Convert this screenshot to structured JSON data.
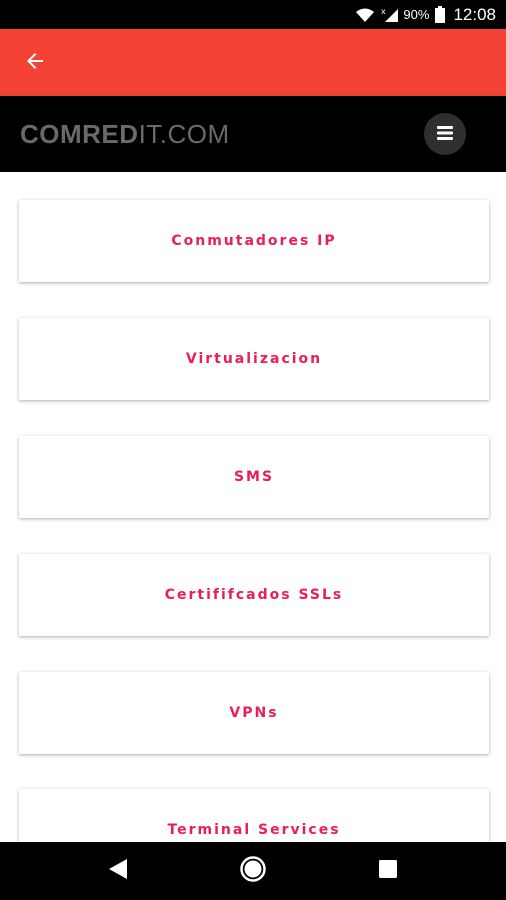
{
  "status_bar": {
    "battery": "90%",
    "time": "12:08"
  },
  "header": {
    "logo_bold": "COMRED",
    "logo_light": "IT.COM"
  },
  "menu_items": [
    "Conmutadores IP",
    "Virtualizacion",
    "SMS",
    "Certififcados SSLs",
    "VPNs",
    "Terminal Services"
  ],
  "colors": {
    "app_bar": "#f44336",
    "item_text": "#e91e5a",
    "header_bg": "#000000"
  },
  "icons": {
    "back": "arrow-left-icon",
    "menu": "hamburger-icon",
    "nav_back": "triangle-back-icon",
    "nav_home": "circle-home-icon",
    "nav_recents": "square-recents-icon"
  }
}
